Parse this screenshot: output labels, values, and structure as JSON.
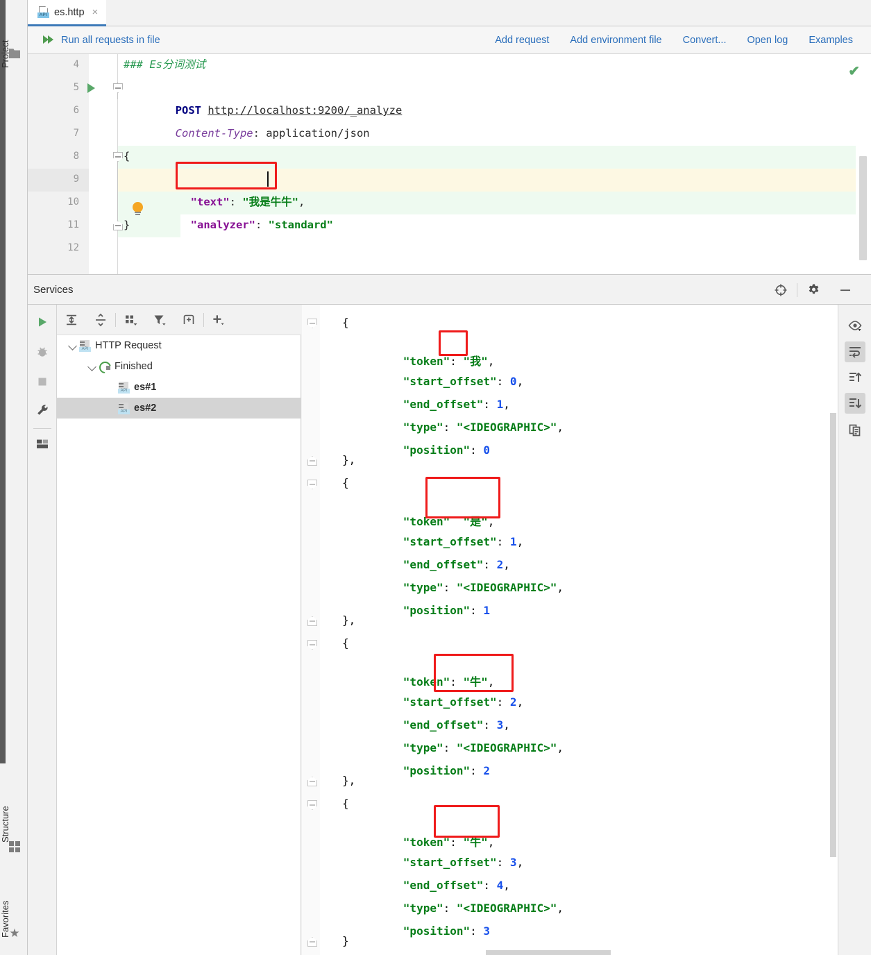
{
  "window": {
    "left_strip": [
      {
        "label": "Project",
        "icon": "folder-icon"
      },
      {
        "label": "Structure",
        "icon": "structure-icon"
      },
      {
        "label": "Favorites",
        "icon": "star-icon"
      }
    ]
  },
  "tab": {
    "filename": "es.http",
    "icon": "http-api-file-icon",
    "close": "×"
  },
  "request_toolbar": {
    "run_all": "Run all requests in file",
    "links": [
      "Add request",
      "Add environment file",
      "Convert...",
      "Open log",
      "Examples"
    ]
  },
  "editor": {
    "status_icon": "inspection-ok-checkmark",
    "lines": [
      {
        "num": "4",
        "text": "### Es分词测试"
      },
      {
        "num": "5",
        "text": "POST http://localhost:9200/_analyze"
      },
      {
        "num": "6",
        "text": "Content-Type: application/json"
      },
      {
        "num": "7",
        "text": ""
      },
      {
        "num": "8",
        "text": "{"
      },
      {
        "num": "9",
        "text": "  \"text\": \"我是牛牛\","
      },
      {
        "num": "10",
        "text": "  \"analyzer\": \"standard\""
      },
      {
        "num": "11",
        "text": "}"
      },
      {
        "num": "12",
        "text": ""
      }
    ],
    "method": "POST",
    "url": "http://localhost:9200/_analyze",
    "header_name": "Content-Type",
    "header_value": ": application/json",
    "comment": "### Es分词测试",
    "body": {
      "open_brace": "{",
      "text_key": "\"text\"",
      "text_colon": ": ",
      "text_value": "\"我是牛牛\"",
      "text_comma": ",",
      "analyzer_key": "\"analyzer\"",
      "analyzer_colon": ": ",
      "analyzer_value": "\"standard\"",
      "close_brace": "}"
    }
  },
  "services": {
    "title": "Services",
    "header_icons": [
      "locate-target-icon",
      "gear-icon",
      "minimize-icon"
    ],
    "left_tools": [
      "run-icon",
      "debug-icon",
      "stop-icon",
      "wrench-icon",
      "layout-icon"
    ],
    "tree_toolbar": [
      "expand-all-icon",
      "collapse-all-icon",
      "group-by-icon",
      "filter-icon",
      "add-tab-icon",
      "plus-icon"
    ],
    "tree": [
      {
        "label": "HTTP Request",
        "icon": "http-api-file-icon",
        "expanded": true,
        "depth": 0,
        "bold": false,
        "selected": false
      },
      {
        "label": "Finished",
        "icon": "refresh-icon",
        "expanded": true,
        "depth": 1,
        "bold": false,
        "selected": false
      },
      {
        "label": "es#1",
        "icon": "http-api-file-icon",
        "expanded": null,
        "depth": 2,
        "bold": true,
        "selected": false
      },
      {
        "label": "es#2",
        "icon": "http-api-file-icon",
        "expanded": null,
        "depth": 2,
        "bold": true,
        "selected": true
      }
    ],
    "console_sidebar": [
      {
        "icon": "eye-preview-icon",
        "active": false
      },
      {
        "icon": "soft-wrap-icon",
        "active": true
      },
      {
        "icon": "scroll-to-top-icon",
        "active": false
      },
      {
        "icon": "scroll-to-end-icon",
        "active": true
      },
      {
        "icon": "copy-icon",
        "active": false
      }
    ]
  },
  "response": {
    "tokens": [
      {
        "token": "\"我\"",
        "start_offset": "0",
        "end_offset": "1",
        "type": "\"<IDEOGRAPHIC>\"",
        "position": "0"
      },
      {
        "token": "\"是\"",
        "start_offset": "1",
        "end_offset": "2",
        "type": "\"<IDEOGRAPHIC>\"",
        "position": "1"
      },
      {
        "token": "\"牛\"",
        "start_offset": "2",
        "end_offset": "3",
        "type": "\"<IDEOGRAPHIC>\"",
        "position": "2"
      },
      {
        "token": "\"牛\"",
        "start_offset": "3",
        "end_offset": "4",
        "type": "\"<IDEOGRAPHIC>\"",
        "position": "3"
      }
    ],
    "labels": {
      "token": "\"token\"",
      "start_offset": "\"start_offset\"",
      "end_offset": "\"end_offset\"",
      "type": "\"type\"",
      "position": "\"position\"",
      "open": "{",
      "close_comma": "},",
      "close": "}",
      "colon": ": ",
      "comma": ","
    }
  },
  "colors": {
    "accent_link": "#2a6ebb",
    "annotation_box": "#ef1b1b",
    "string_green": "#067d17",
    "number_blue": "#1750eb",
    "key_purple": "#871094",
    "caret_line": "#fdf8e3",
    "block_band": "#eefaf0",
    "selection": "#d4d4d4"
  }
}
